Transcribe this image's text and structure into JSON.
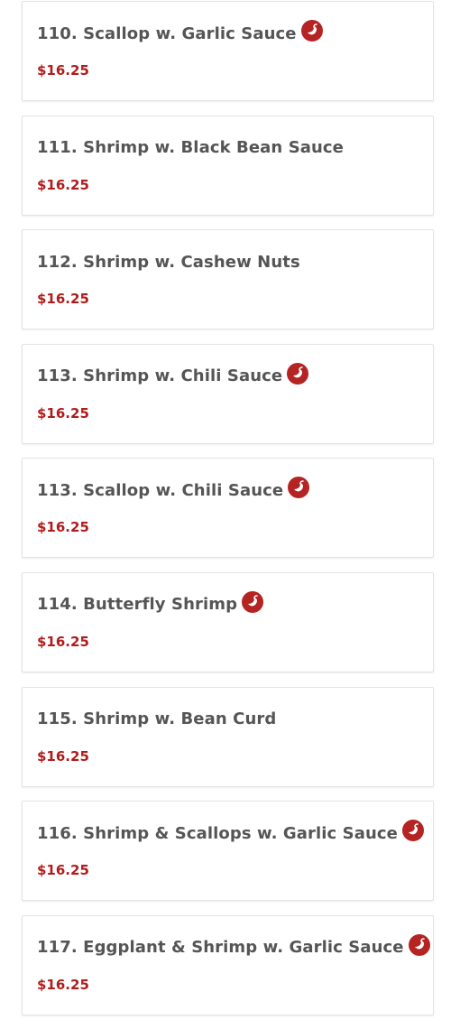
{
  "colors": {
    "name_text": "#555555",
    "price_text": "#b01c1c",
    "spicy_icon": "#b52323",
    "card_border": "#e3e3e3"
  },
  "menu": {
    "items": [
      {
        "name": "110. Scallop w. Garlic Sauce",
        "price": "$16.25",
        "spicy": true,
        "icon": "chili-pepper-icon"
      },
      {
        "name": "111. Shrimp w. Black Bean Sauce",
        "price": "$16.25",
        "spicy": false
      },
      {
        "name": "112. Shrimp w. Cashew Nuts",
        "price": "$16.25",
        "spicy": false
      },
      {
        "name": "113. Shrimp w. Chili Sauce",
        "price": "$16.25",
        "spicy": true,
        "icon": "chili-pepper-icon"
      },
      {
        "name": "113. Scallop w. Chili Sauce",
        "price": "$16.25",
        "spicy": true,
        "icon": "chili-pepper-icon"
      },
      {
        "name": "114. Butterfly Shrimp",
        "price": "$16.25",
        "spicy": true,
        "icon": "chili-pepper-icon"
      },
      {
        "name": "115. Shrimp w. Bean Curd",
        "price": "$16.25",
        "spicy": false
      },
      {
        "name": "116. Shrimp & Scallops w. Garlic Sauce",
        "price": "$16.25",
        "spicy": true,
        "icon": "chili-pepper-icon"
      },
      {
        "name": "117. Eggplant & Shrimp w. Garlic Sauce",
        "price": "$16.25",
        "spicy": true,
        "icon": "chili-pepper-icon"
      }
    ]
  }
}
